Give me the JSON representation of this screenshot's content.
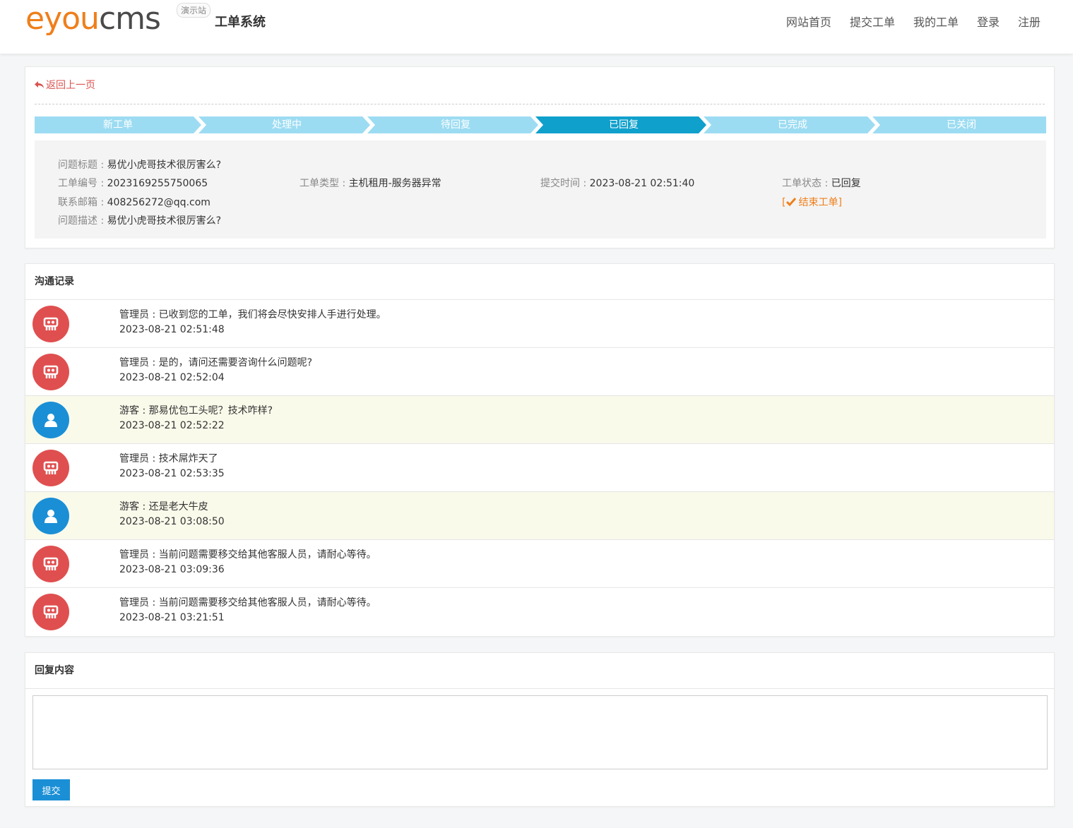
{
  "header": {
    "logo_part1": "e",
    "logo_part2": "you",
    "logo_part3": "cms",
    "badge": "演示站",
    "system_name": "工单系统",
    "nav": [
      "网站首页",
      "提交工单",
      "我的工单",
      "登录",
      "注册"
    ]
  },
  "ticket": {
    "back_label": "返回上一页",
    "steps": [
      "新工单",
      "处理中",
      "待回复",
      "已回复",
      "已完成",
      "已关闭"
    ],
    "active_step": "已回复",
    "colors": {
      "step_inactive": "#9cdcf2",
      "step_active": "#0fa0cc",
      "orange": "#ef7f1a",
      "red": "#e04f4f",
      "blue": "#1a8fd6"
    },
    "fields": {
      "title_label": "问题标题 : ",
      "title_value": "易优小虎哥技术很厉害么?",
      "number_label": "工单编号 : ",
      "number_value": "2023169255750065",
      "type_label": "工单类型 : ",
      "type_value": "主机租用-服务器异常",
      "time_label": "提交时间 : ",
      "time_value": "2023-08-21 02:51:40",
      "status_label": "工单状态 : ",
      "status_value": "已回复",
      "email_label": "联系邮箱 : ",
      "email_value": "408256272@qq.com",
      "close_label": "结束工单",
      "desc_label": "问题描述 : ",
      "desc_value": "易优小虎哥技术很厉害么?"
    }
  },
  "communication": {
    "title": "沟通记录",
    "messages": [
      {
        "role": "admin",
        "text": "管理员 : 已收到您的工单，我们将会尽快安排人手进行处理。",
        "time": "2023-08-21 02:51:48"
      },
      {
        "role": "admin",
        "text": "管理员 : 是的，请问还需要咨询什么问题呢?",
        "time": "2023-08-21 02:52:04"
      },
      {
        "role": "guest",
        "text": "游客 : 那易优包工头呢？技术咋样?",
        "time": "2023-08-21 02:52:22"
      },
      {
        "role": "admin",
        "text": "管理员 : 技术屌炸天了",
        "time": "2023-08-21 02:53:35"
      },
      {
        "role": "guest",
        "text": "游客 : 还是老大牛皮",
        "time": "2023-08-21 03:08:50"
      },
      {
        "role": "admin",
        "text": "管理员 : 当前问题需要移交给其他客服人员，请耐心等待。",
        "time": "2023-08-21 03:09:36"
      },
      {
        "role": "admin",
        "text": "管理员 : 当前问题需要移交给其他客服人员，请耐心等待。",
        "time": "2023-08-21 03:21:51"
      }
    ]
  },
  "reply": {
    "title": "回复内容",
    "textarea_value": "",
    "submit_label": "提交"
  }
}
